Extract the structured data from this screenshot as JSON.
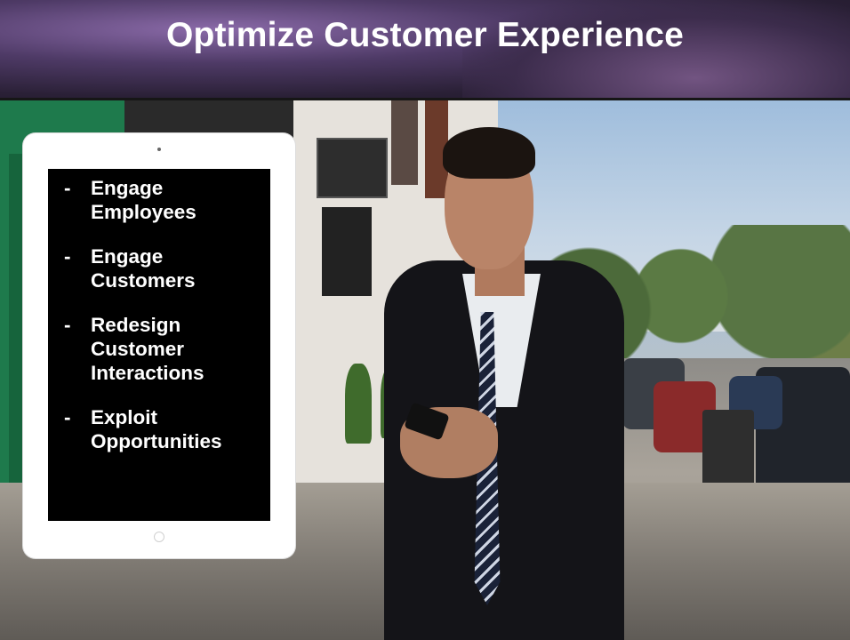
{
  "slide": {
    "title": "Optimize Customer Experience"
  },
  "tablet": {
    "bullets": [
      {
        "marker": "-",
        "text": "Engage Employees"
      },
      {
        "marker": "-",
        "text": "Engage Customers"
      },
      {
        "marker": "-",
        "text": "Redesign Customer Interactions"
      },
      {
        "marker": "-",
        "text": "Exploit Opportunities"
      }
    ]
  }
}
